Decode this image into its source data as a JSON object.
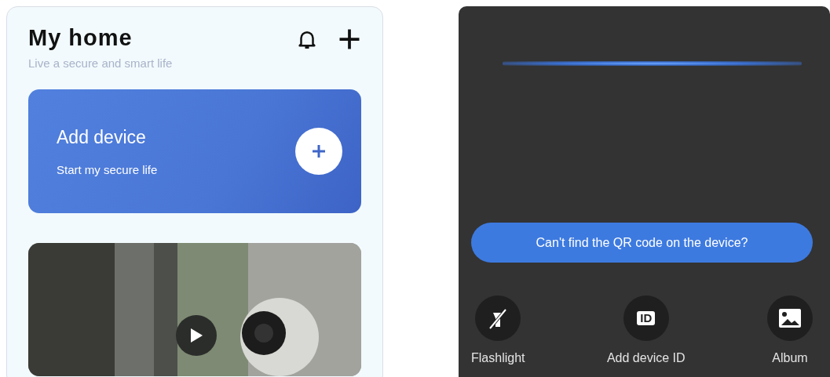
{
  "home": {
    "title": "My home",
    "subtitle": "Live a secure and smart life",
    "add_card": {
      "title": "Add device",
      "subtitle": "Start my secure life"
    }
  },
  "scan": {
    "help_button": "Can't find the QR code on the device?",
    "tools": [
      {
        "kind": "flashlight",
        "label": "Flashlight",
        "on": false
      },
      {
        "kind": "id",
        "label": "Add device ID",
        "badge": "ID"
      },
      {
        "kind": "album",
        "label": "Album"
      }
    ]
  }
}
